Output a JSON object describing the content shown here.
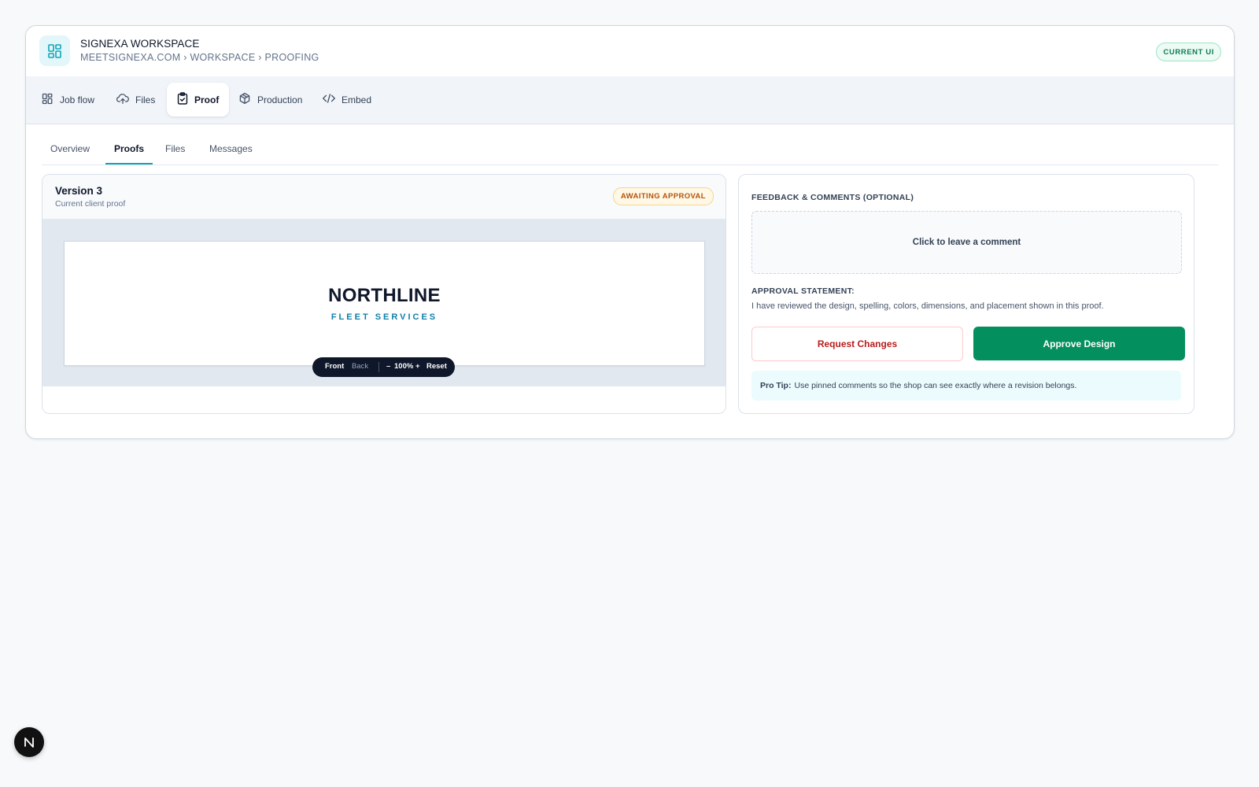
{
  "header": {
    "title": "SIGNEXA WORKSPACE",
    "breadcrumb": "MEETSIGNEXA.COM › WORKSPACE › PROOFING",
    "ui_badge": "CURRENT UI",
    "logo_icon": "dashboard-grid-icon"
  },
  "nav": {
    "items": [
      {
        "label": "Job flow",
        "icon": "dashboard-grid-icon",
        "active": false
      },
      {
        "label": "Files",
        "icon": "cloud-upload-icon",
        "active": false
      },
      {
        "label": "Proof",
        "icon": "clipboard-check-icon",
        "active": true
      },
      {
        "label": "Production",
        "icon": "package-icon",
        "active": false
      },
      {
        "label": "Embed",
        "icon": "code-icon",
        "active": false
      }
    ]
  },
  "subtabs": {
    "items": [
      {
        "label": "Overview",
        "active": false
      },
      {
        "label": "Proofs",
        "active": true
      },
      {
        "label": "Files",
        "active": false
      },
      {
        "label": "Messages",
        "active": false
      }
    ]
  },
  "proof": {
    "version_title": "Version 3",
    "version_subtitle": "Current client proof",
    "status_badge": "AWAITING APPROVAL",
    "artwork": {
      "title": "NORTHLINE",
      "subtitle": "FLEET SERVICES"
    },
    "viewer": {
      "front": "Front",
      "back": "Back",
      "zoom_out": "–",
      "zoom": "100%",
      "zoom_in": "+",
      "reset": "Reset"
    }
  },
  "feedback": {
    "label": "FEEDBACK & COMMENTS (OPTIONAL)",
    "comment_prompt": "Click to leave a comment",
    "approval_label": "APPROVAL STATEMENT:",
    "approval_text": "I have reviewed the design, spelling, colors, dimensions, and placement shown in this proof.",
    "request_changes": "Request Changes",
    "approve": "Approve Design",
    "tip_label": "Pro Tip:",
    "tip_text": "Use pinned comments so the shop can see exactly where a revision belongs."
  },
  "dev_badge": {
    "label": "N"
  },
  "colors": {
    "accent": "#0ea5b7",
    "approve": "#04905e",
    "request": "#b91c1c",
    "awaiting": "#b45309"
  }
}
